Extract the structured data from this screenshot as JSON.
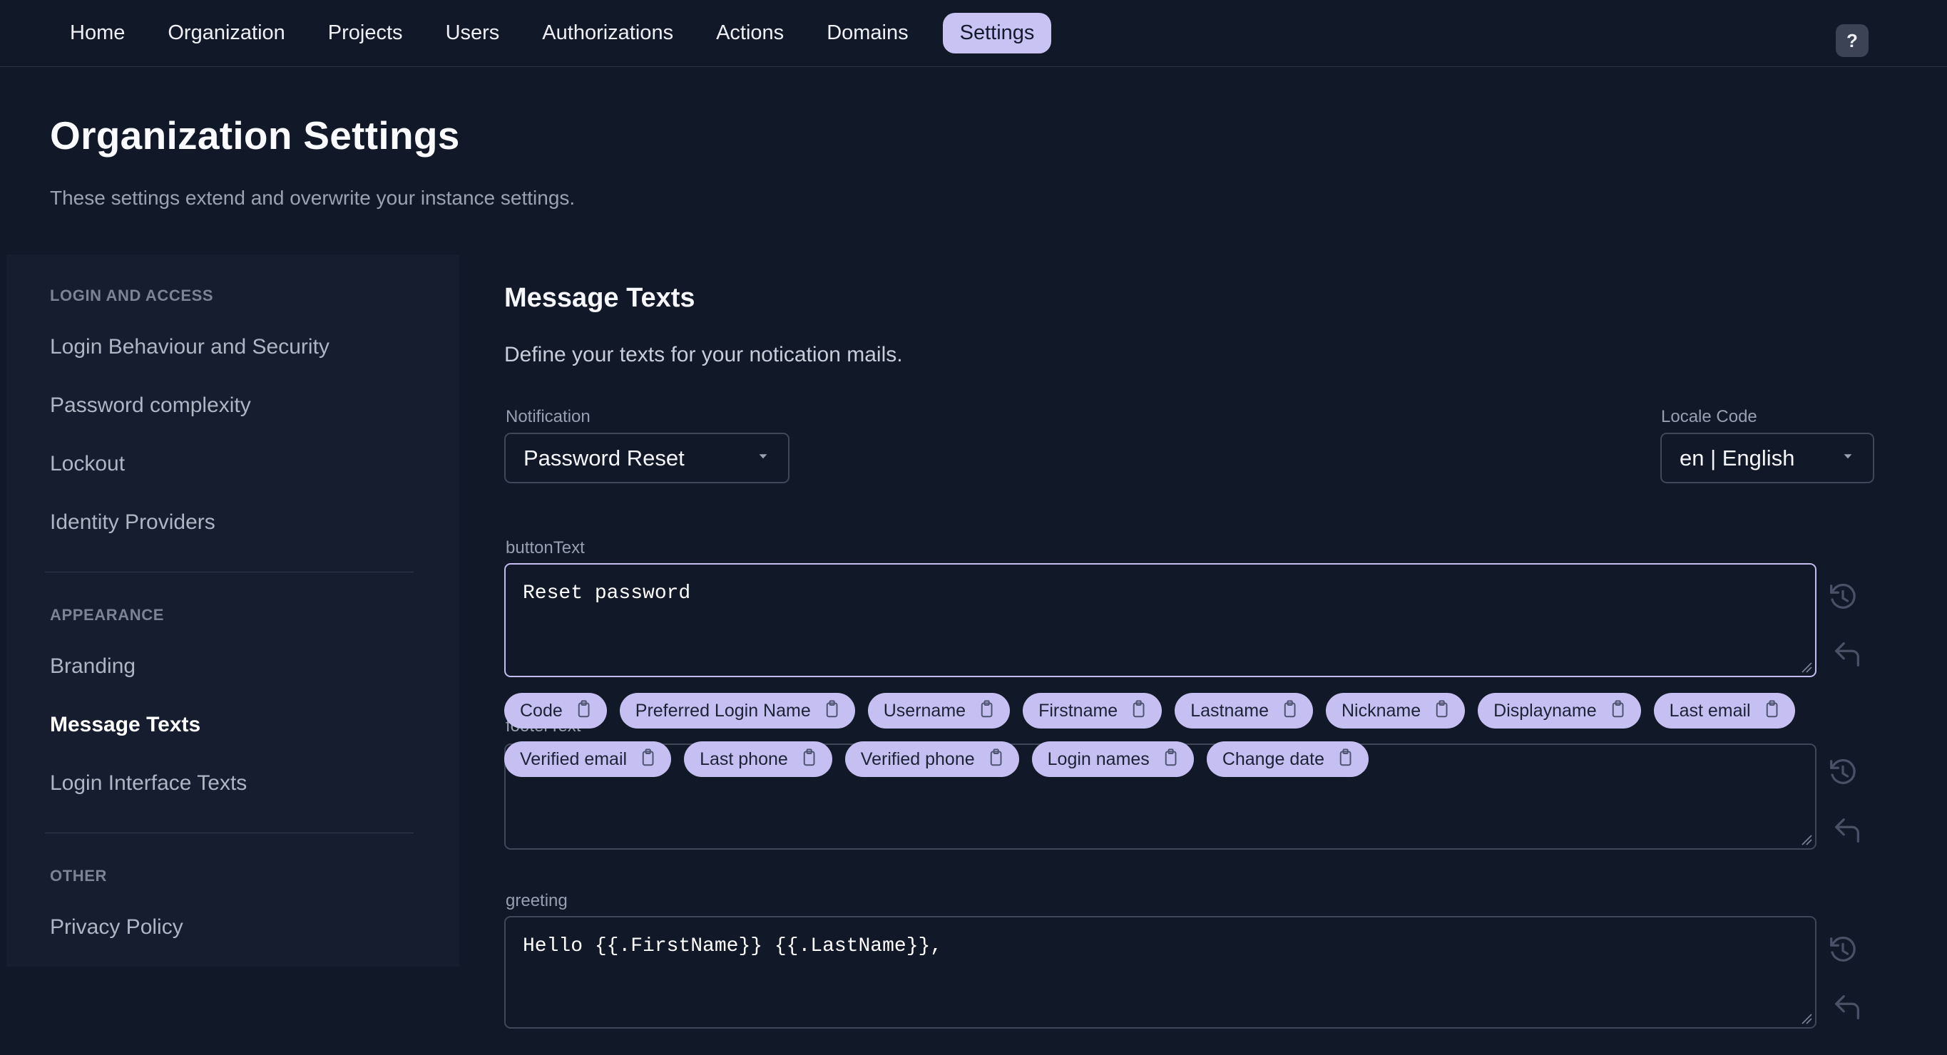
{
  "nav": {
    "items": [
      {
        "label": "Home"
      },
      {
        "label": "Organization"
      },
      {
        "label": "Projects"
      },
      {
        "label": "Users"
      },
      {
        "label": "Authorizations"
      },
      {
        "label": "Actions"
      },
      {
        "label": "Domains"
      },
      {
        "label": "Settings"
      }
    ],
    "active_item": "Settings",
    "help_label": "?"
  },
  "header": {
    "title": "Organization Settings",
    "subtitle": "These settings extend and overwrite your instance settings."
  },
  "sidebar": {
    "active_item": "Message Texts",
    "sections": [
      {
        "title": "LOGIN AND ACCESS",
        "items": [
          {
            "label": "Login Behaviour and Security"
          },
          {
            "label": "Password complexity"
          },
          {
            "label": "Lockout"
          },
          {
            "label": "Identity Providers"
          }
        ]
      },
      {
        "title": "APPEARANCE",
        "items": [
          {
            "label": "Branding"
          },
          {
            "label": "Message Texts"
          },
          {
            "label": "Login Interface Texts"
          }
        ]
      },
      {
        "title": "OTHER",
        "items": [
          {
            "label": "Privacy Policy"
          }
        ]
      }
    ]
  },
  "main": {
    "title": "Message Texts",
    "subtitle": "Define your texts for your notication mails.",
    "notification": {
      "label": "Notification",
      "value": "Password Reset"
    },
    "locale": {
      "label": "Locale Code",
      "value": "en | English"
    },
    "fields": [
      {
        "label": "buttonText",
        "value": "Reset password",
        "focused": true
      },
      {
        "label": "footerText",
        "value": "",
        "focused": false
      },
      {
        "label": "greeting",
        "value": "Hello {{.FirstName}} {{.LastName}},",
        "focused": false
      }
    ],
    "chips": [
      "Code",
      "Preferred Login Name",
      "Username",
      "Firstname",
      "Lastname",
      "Nickname",
      "Displayname",
      "Last email",
      "Verified email",
      "Last phone",
      "Verified phone",
      "Login names",
      "Change date"
    ]
  },
  "icons": {
    "help": "question-mark",
    "select_caret": "caret-down",
    "chip_icon": "clipboard-copy",
    "textarea_icon_1": "history-restore",
    "textarea_icon_2": "undo-arrow",
    "textarea_corner": "resize-handle"
  },
  "colors": {
    "background": "#111827",
    "sidebar_panel": "#151d2e",
    "accent_lavender": "#c6c0f2",
    "chip_text": "#1d2236",
    "focused_border": "#c3bdf2",
    "input_border": "#3f4759",
    "muted_label": "#97a0b0",
    "icon_gray": "#4a5166"
  }
}
